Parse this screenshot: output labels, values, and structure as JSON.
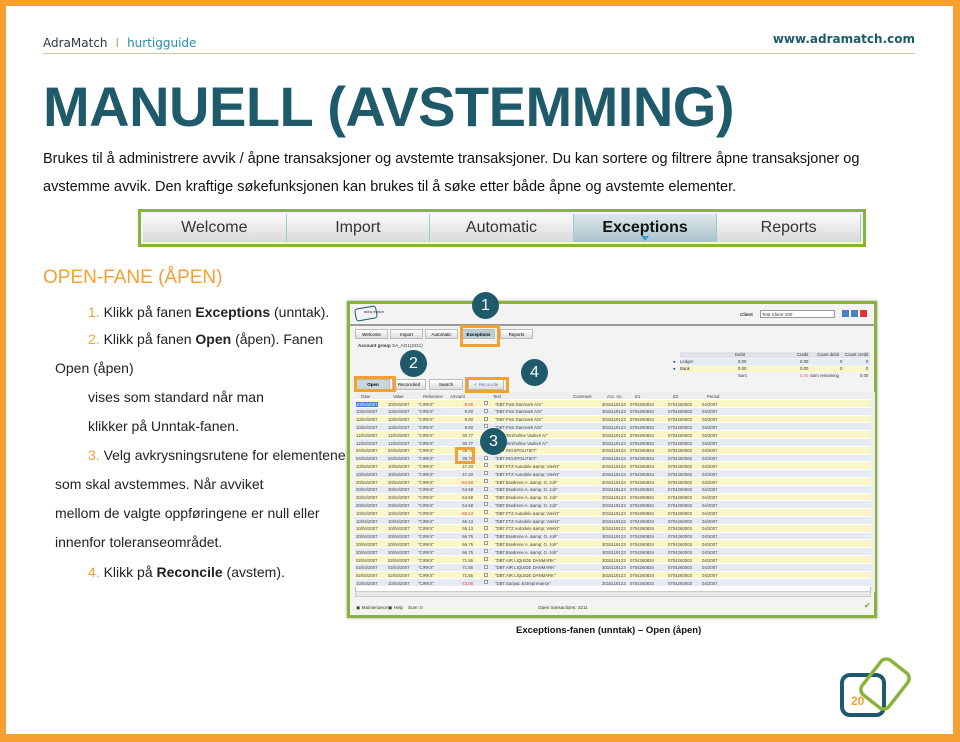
{
  "header": {
    "brand": "AdraMatch",
    "separator": "I",
    "guide": "hurtigguide",
    "url": "www.adramatch.com"
  },
  "title": "MANUELL (AVSTEMMING)",
  "intro": "Brukes til å administrere avvik / åpne transaksjoner og avstemte transaksjoner. Du kan sortere og filtrere åpne transaksjoner og avstemme avvik. Den kraftige søkefunksjonen kan brukes til å søke etter både åpne og avstemte elementer.",
  "nav": {
    "tabs": [
      "Welcome",
      "Import",
      "Automatic",
      "Exceptions",
      "Reports"
    ],
    "active": "Exceptions"
  },
  "section_title": "OPEN-FANE (ÅPEN)",
  "steps": [
    {
      "num": "1.",
      "pre": "Klikk på fanen ",
      "bold": "Exceptions",
      "post": " (unntak)."
    },
    {
      "num": "2.",
      "pre": "Klikk på fanen ",
      "bold": "Open",
      "post": " (åpen). Fanen"
    },
    {
      "text": "Open (åpen)"
    },
    {
      "text": "vises som standard når man"
    },
    {
      "text": "klikker på Unntak-fanen."
    },
    {
      "num": "3.",
      "pre": "Velg avkrysningsrutene for elementene",
      "bold": "",
      "post": ""
    },
    {
      "text": "som skal avstemmes. Når avviket"
    },
    {
      "text": "mellom de valgte oppføringene er null eller"
    },
    {
      "text": "innenfor toleranseområdet."
    },
    {
      "num": "4.",
      "pre": "Klikk på ",
      "bold": "Reconcile",
      "post": " (avstem)."
    }
  ],
  "screenshot": {
    "logo": "adra match",
    "client_label": "Client",
    "client_value": "Test Client 100",
    "tabs": [
      "Welcome",
      "Import",
      "Automatic",
      "Exceptions",
      "Reports"
    ],
    "account_group_label": "Account group",
    "account_group_value": "SA_AG1(2211)",
    "subtabs": [
      "Open",
      "Reconciled",
      "Search"
    ],
    "reconcile": "Reconcile",
    "summary": {
      "headers": [
        "Debit",
        "Credit",
        "Count debit",
        "Count credit"
      ],
      "ledger": [
        "Ledger",
        "0.00",
        "0.00",
        "0",
        "0"
      ],
      "bank": [
        "Bank",
        "0.00",
        "0.00",
        "0",
        "0"
      ],
      "sum": [
        "Sum",
        "0.00",
        "Sum remaining",
        "0.00"
      ]
    },
    "columns": [
      "Date",
      "Value",
      "Reference",
      "Amount",
      "",
      "Text",
      "Comment",
      "Acc. no",
      "E1",
      "E2",
      "Period"
    ],
    "rows": [
      [
        "10/04/2007",
        "10/04/2007",
        "\"CIRKX\"",
        "-9.00",
        "\"DBT.Post Danmark A/S\""
      ],
      [
        "10/04/2007",
        "10/04/2007",
        "\"CIRKX\"",
        "9.00",
        "\"DBT.Post Danmark A/S\""
      ],
      [
        "10/04/2007",
        "10/04/2007",
        "\"CIRKX\"",
        "9.00",
        "\"DBT.Post Danmark A/S\""
      ],
      [
        "10/04/2007",
        "10/04/2007",
        "\"CIRKX\"",
        "9.00",
        "\"DBT.Post Danmark A/S\""
      ],
      [
        "12/04/2007",
        "12/04/2007",
        "\"CIRKX\"",
        "30.77",
        "\"DBT.Tornholme Vaskeri A/\""
      ],
      [
        "12/04/2007",
        "12/04/2007",
        "\"CIRKX\"",
        "30.77",
        "\"DBT.Tornholme Vaskeri A/\""
      ],
      [
        "04/04/2007",
        "04/04/2007",
        "\"CIRKX\"",
        "39.76",
        "\"DBT.RIGSPOLITIET\""
      ],
      [
        "04/04/2007",
        "04/04/2007",
        "\"CIRKX\"",
        "39.76",
        "\"DBT.RIGSPOLITIET\""
      ],
      [
        "10/04/2007",
        "10/04/2007",
        "\"CIRKX\"",
        "47.20",
        "\"DBT.FTZ Autodele &amp; Værkt\""
      ],
      [
        "10/04/2007",
        "10/04/2007",
        "\"CIRKX\"",
        "47.20",
        "\"DBT.FTZ Autodele &amp; Værkt\""
      ],
      [
        "20/04/2007",
        "20/04/2007",
        "\"CIRKX\"",
        "-54.58",
        "\"DBT.Brødrene A. &amp; O. Joh\""
      ],
      [
        "20/04/2007",
        "20/04/2007",
        "\"CIRKX\"",
        "54.58",
        "\"DBT.Brødrene A. &amp; O. Joh\""
      ],
      [
        "20/04/2007",
        "20/04/2007",
        "\"CIRKX\"",
        "54.58",
        "\"DBT.Brødrene A. &amp; O. Joh\""
      ],
      [
        "20/04/2007",
        "20/04/2007",
        "\"CIRKX\"",
        "54.58",
        "\"DBT.Brødrene A. &amp; O. Joh\""
      ],
      [
        "10/04/2007",
        "10/04/2007",
        "\"CIRKX\"",
        "-55.13",
        "\"DBT.FTZ Autodele &amp; Værkt\""
      ],
      [
        "10/04/2007",
        "10/04/2007",
        "\"CIRKX\"",
        "55.13",
        "\"DBT.FTZ Autodele &amp; Værkt\""
      ],
      [
        "10/04/2007",
        "10/04/2007",
        "\"CIRKX\"",
        "55.13",
        "\"DBT.FTZ Autodele &amp; Værkt\""
      ],
      [
        "20/04/2007",
        "20/04/2007",
        "\"CIRKX\"",
        "66.75",
        "\"DBT.Brødrene A. &amp; O. Joh\""
      ],
      [
        "20/04/2007",
        "20/04/2007",
        "\"CIRKX\"",
        "66.75",
        "\"DBT.Brødrene A. &amp; O. Joh\""
      ],
      [
        "20/04/2007",
        "20/04/2007",
        "\"CIRKX\"",
        "66.75",
        "\"DBT.Brødrene A. &amp; O. Joh\""
      ],
      [
        "02/04/2007",
        "02/04/2007",
        "\"CIRKX\"",
        "71.55",
        "\"DBT.AIR LIQUIDE DANMARK\""
      ],
      [
        "02/04/2007",
        "02/04/2007",
        "\"CIRKX\"",
        "71.55",
        "\"DBT.AIR LIQUIDE DANMARK\""
      ],
      [
        "02/04/2007",
        "02/04/2007",
        "\"CIRKX\"",
        "71.55",
        "\"DBT.AIR LIQUIDE DANMARK\""
      ],
      [
        "10/04/2007",
        "10/04/2007",
        "\"CIRKX\"",
        "-73.00",
        "\"DBT.Sanpac Entreprenørne\""
      ]
    ],
    "row_common": {
      "acc": "3015119123",
      "e1": "0704260834",
      "e2": "0704260003",
      "period": "04/2007"
    },
    "status": {
      "maintenance": "Maintenance",
      "help": "Help",
      "sum": "Sum: 0",
      "open": "Open transactions: 2211"
    },
    "callouts": [
      "1",
      "2",
      "3",
      "4"
    ]
  },
  "caption": "Exceptions-fanen (unntak) – Open (åpen)",
  "page_number": "20",
  "colors": {
    "accent_orange": "#f5a031",
    "title_teal": "#1f5a6b",
    "green": "#8bb33a"
  }
}
